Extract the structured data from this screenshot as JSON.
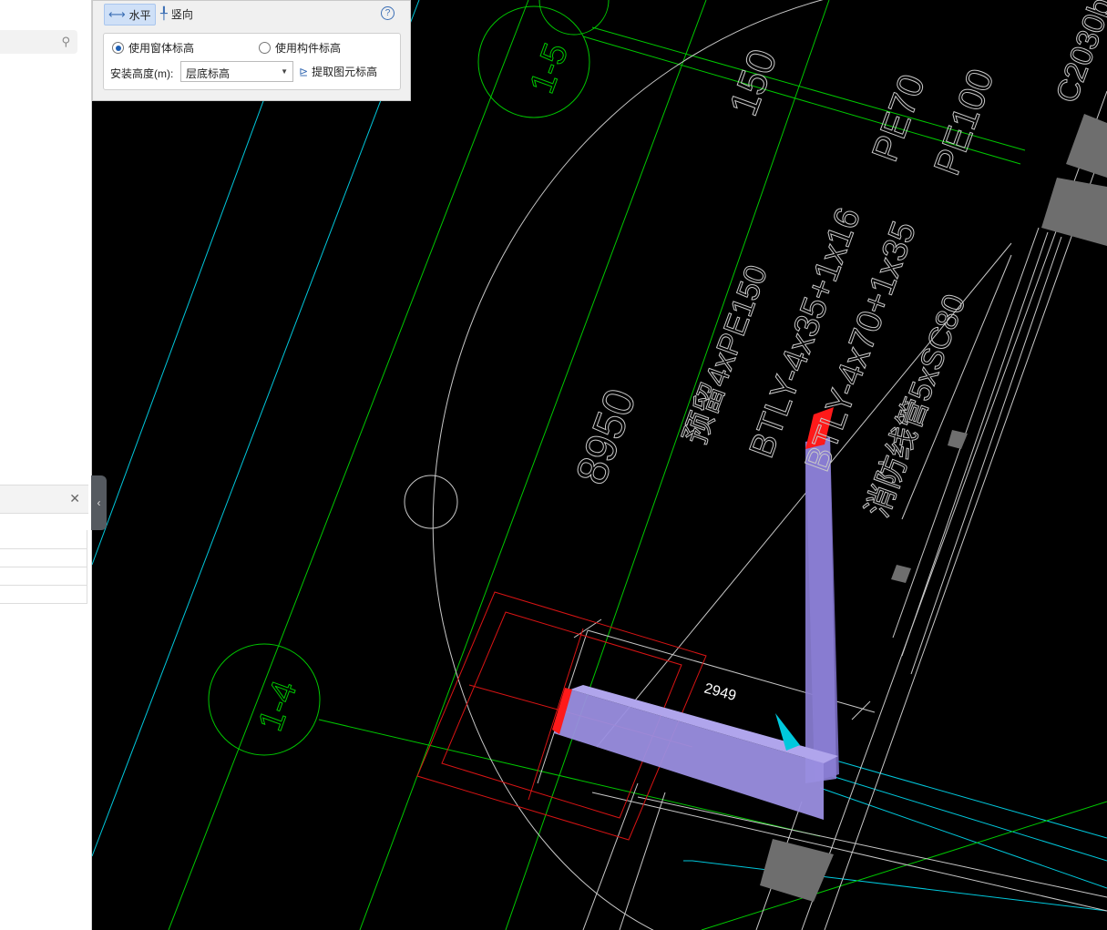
{
  "toolbox": {
    "horizontal_label": "水平",
    "vertical_label": "竖向",
    "help_glyph": "?",
    "radio_window_label": "使用窗体标高",
    "radio_component_label": "使用构件标高",
    "height_label": "安装高度(m):",
    "height_select_value": "层底标高",
    "extract_label": "提取图元标高"
  },
  "drawing": {
    "label_8950": "8950",
    "label_150": "150",
    "label_pe70": "PE70",
    "label_pe100": "PE100",
    "label_4pe150": "预留4xPE150",
    "label_btly1": "BTLY-4x35+1x16",
    "label_btly2": "BTLY-4x70+1x35",
    "label_sc80": "消防线管5xSC80",
    "label_c2030": "C2030b",
    "label_2949": "2949",
    "label_1_5": "1-5",
    "label_1_4": "1-4"
  },
  "colors": {
    "canvas": "#000000",
    "grid_green": "#00c800",
    "cyan": "#00c8dc",
    "pipe_fill": "#9a8ee0",
    "end_red": "#ff1a1a",
    "footprint_red": "#d81414"
  },
  "left_panel": {
    "close_glyph": "✕",
    "collapse_glyph": "‹"
  }
}
